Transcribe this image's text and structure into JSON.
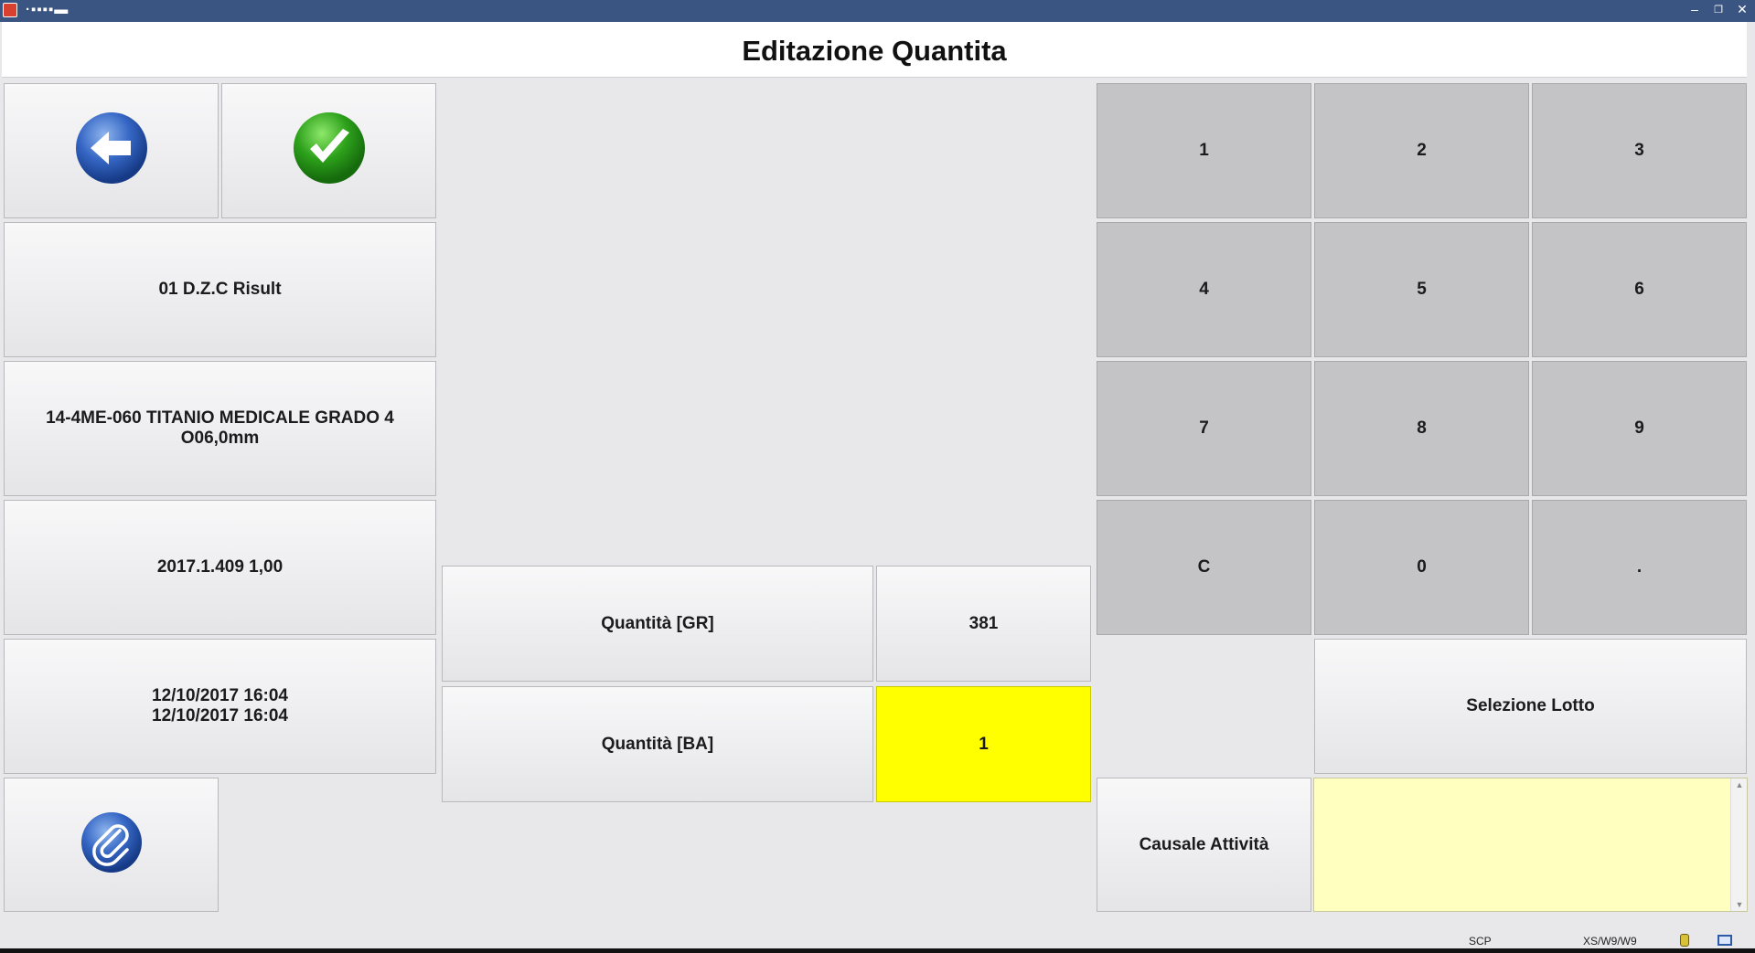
{
  "window": {
    "app_name": "·▪▪▪▪▬",
    "minimize": "–",
    "restore": "❐",
    "close": "✕"
  },
  "header": {
    "title": "Editazione Quantita"
  },
  "left": {
    "back_icon": "arrow-left-icon",
    "confirm_icon": "checkmark-icon",
    "operator": "01 D.Z.C Risult",
    "article": "14-4ME-060 TITANIO MEDICALE GRADO 4 O06,0mm",
    "lot": "2017.1.409 1,00",
    "dates": [
      "12/10/2017 16:04",
      "12/10/2017 16:04"
    ],
    "attach_icon": "paperclip-icon"
  },
  "quantities": [
    {
      "label": "Quantità [GR]",
      "value": "381",
      "highlighted": false
    },
    {
      "label": "Quantità [BA]",
      "value": "1",
      "highlighted": true
    }
  ],
  "keypad": {
    "keys": [
      "1",
      "2",
      "3",
      "4",
      "5",
      "6",
      "7",
      "8",
      "9",
      "C",
      "0",
      "."
    ]
  },
  "actions": {
    "lot_selection": "Selezione Lotto",
    "activity_reason": "Causale Attività",
    "notes_value": ""
  },
  "status": {
    "left": "SCP",
    "right": "XS/W9/W9"
  },
  "colors": {
    "titlebar": "#3b5582",
    "highlight": "#ffff00",
    "notes_bg": "#ffffc0",
    "keypad": "#c4c4c6"
  }
}
